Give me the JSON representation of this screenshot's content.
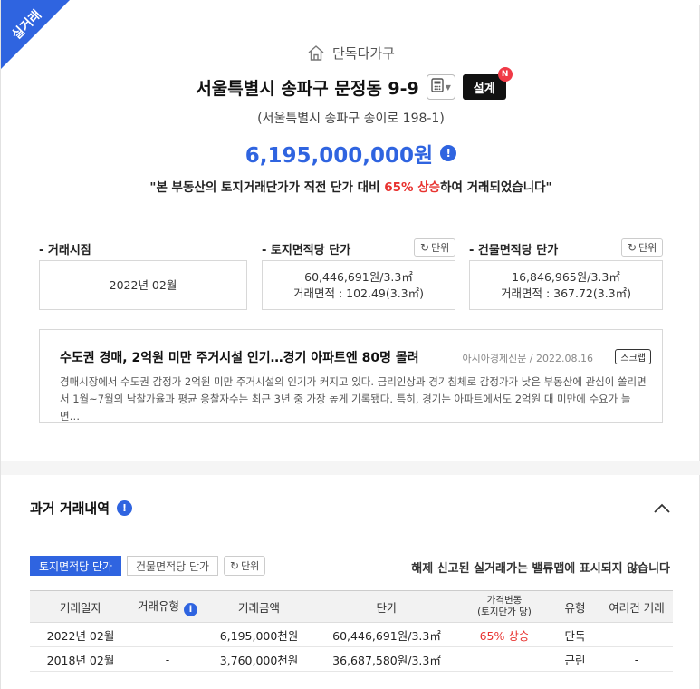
{
  "ribbon": "실거래",
  "property": {
    "type": "단독다가구",
    "address": "서울특별시 송파구 문정동 9-9",
    "road_address": "(서울특별시 송파구 송이로 198-1)",
    "price": "6,195,000,000원",
    "design_label": "설계",
    "design_badge": "N"
  },
  "quote": {
    "pre": "\"본 부동산의 토지거래단가가 직전 단가 대비 ",
    "highlight": "65% 상승",
    "post": "하여 거래되었습니다\""
  },
  "stats": {
    "trade_date": {
      "label": "- 거래시점",
      "value": "2022년 02월"
    },
    "land_unit": {
      "label": "- 토지면적당 단가",
      "value": "60,446,691원/3.3㎡",
      "area": "거래면적 : 102.49(3.3㎡)"
    },
    "building_unit": {
      "label": "- 건물면적당 단가",
      "value": "16,846,965원/3.3㎡",
      "area": "거래면적 : 367.72(3.3㎡)"
    },
    "unit_label": "단위"
  },
  "news": {
    "title": "수도권 경매, 2억원 미만 주거시설 인기…경기 아파트엔 80명 몰려",
    "source": "아시아경제신문 / 2022.08.16",
    "scrap_label": "스크랩",
    "body": "경매시장에서 수도권 감정가 2억원 미만 주거시설의 인기가 커지고 있다. 금리인상과 경기침체로 감정가가 낮은 부동산에 관심이 쏠리면서 1월~7월의 낙찰가율과 평균 응찰자수는 최근 3년 중 가장 높게 기록됐다. 특히, 경기는 아파트에서도 2억원 대 미만에 수요가 늘면…"
  },
  "history": {
    "title": "과거 거래내역",
    "tabs": [
      "토지면적당 단가",
      "건물면적당 단가"
    ],
    "unit_label": "단위",
    "notice": "해제 신고된 실거래가는 밸류맵에 표시되지 않습니다",
    "columns": [
      "거래일자",
      "거래유형",
      "거래금액",
      "단가",
      "가격변동",
      "(토지단가 당)",
      "유형",
      "여러건 거래"
    ],
    "rows": [
      [
        "2022년 02월",
        "-",
        "6,195,000천원",
        "60,446,691원/3.3㎡",
        "65% 상승",
        "단독",
        "-"
      ],
      [
        "2018년 02월",
        "-",
        "3,760,000천원",
        "36,687,580원/3.3㎡",
        "",
        "근린",
        "-"
      ]
    ]
  },
  "colors": {
    "accent": "#2f64e0",
    "up": "#e8322f",
    "badge": "#f03a47"
  },
  "icons": [
    "house-icon",
    "calculator-icon",
    "info-icon",
    "refresh-icon",
    "chevron-up-icon"
  ]
}
